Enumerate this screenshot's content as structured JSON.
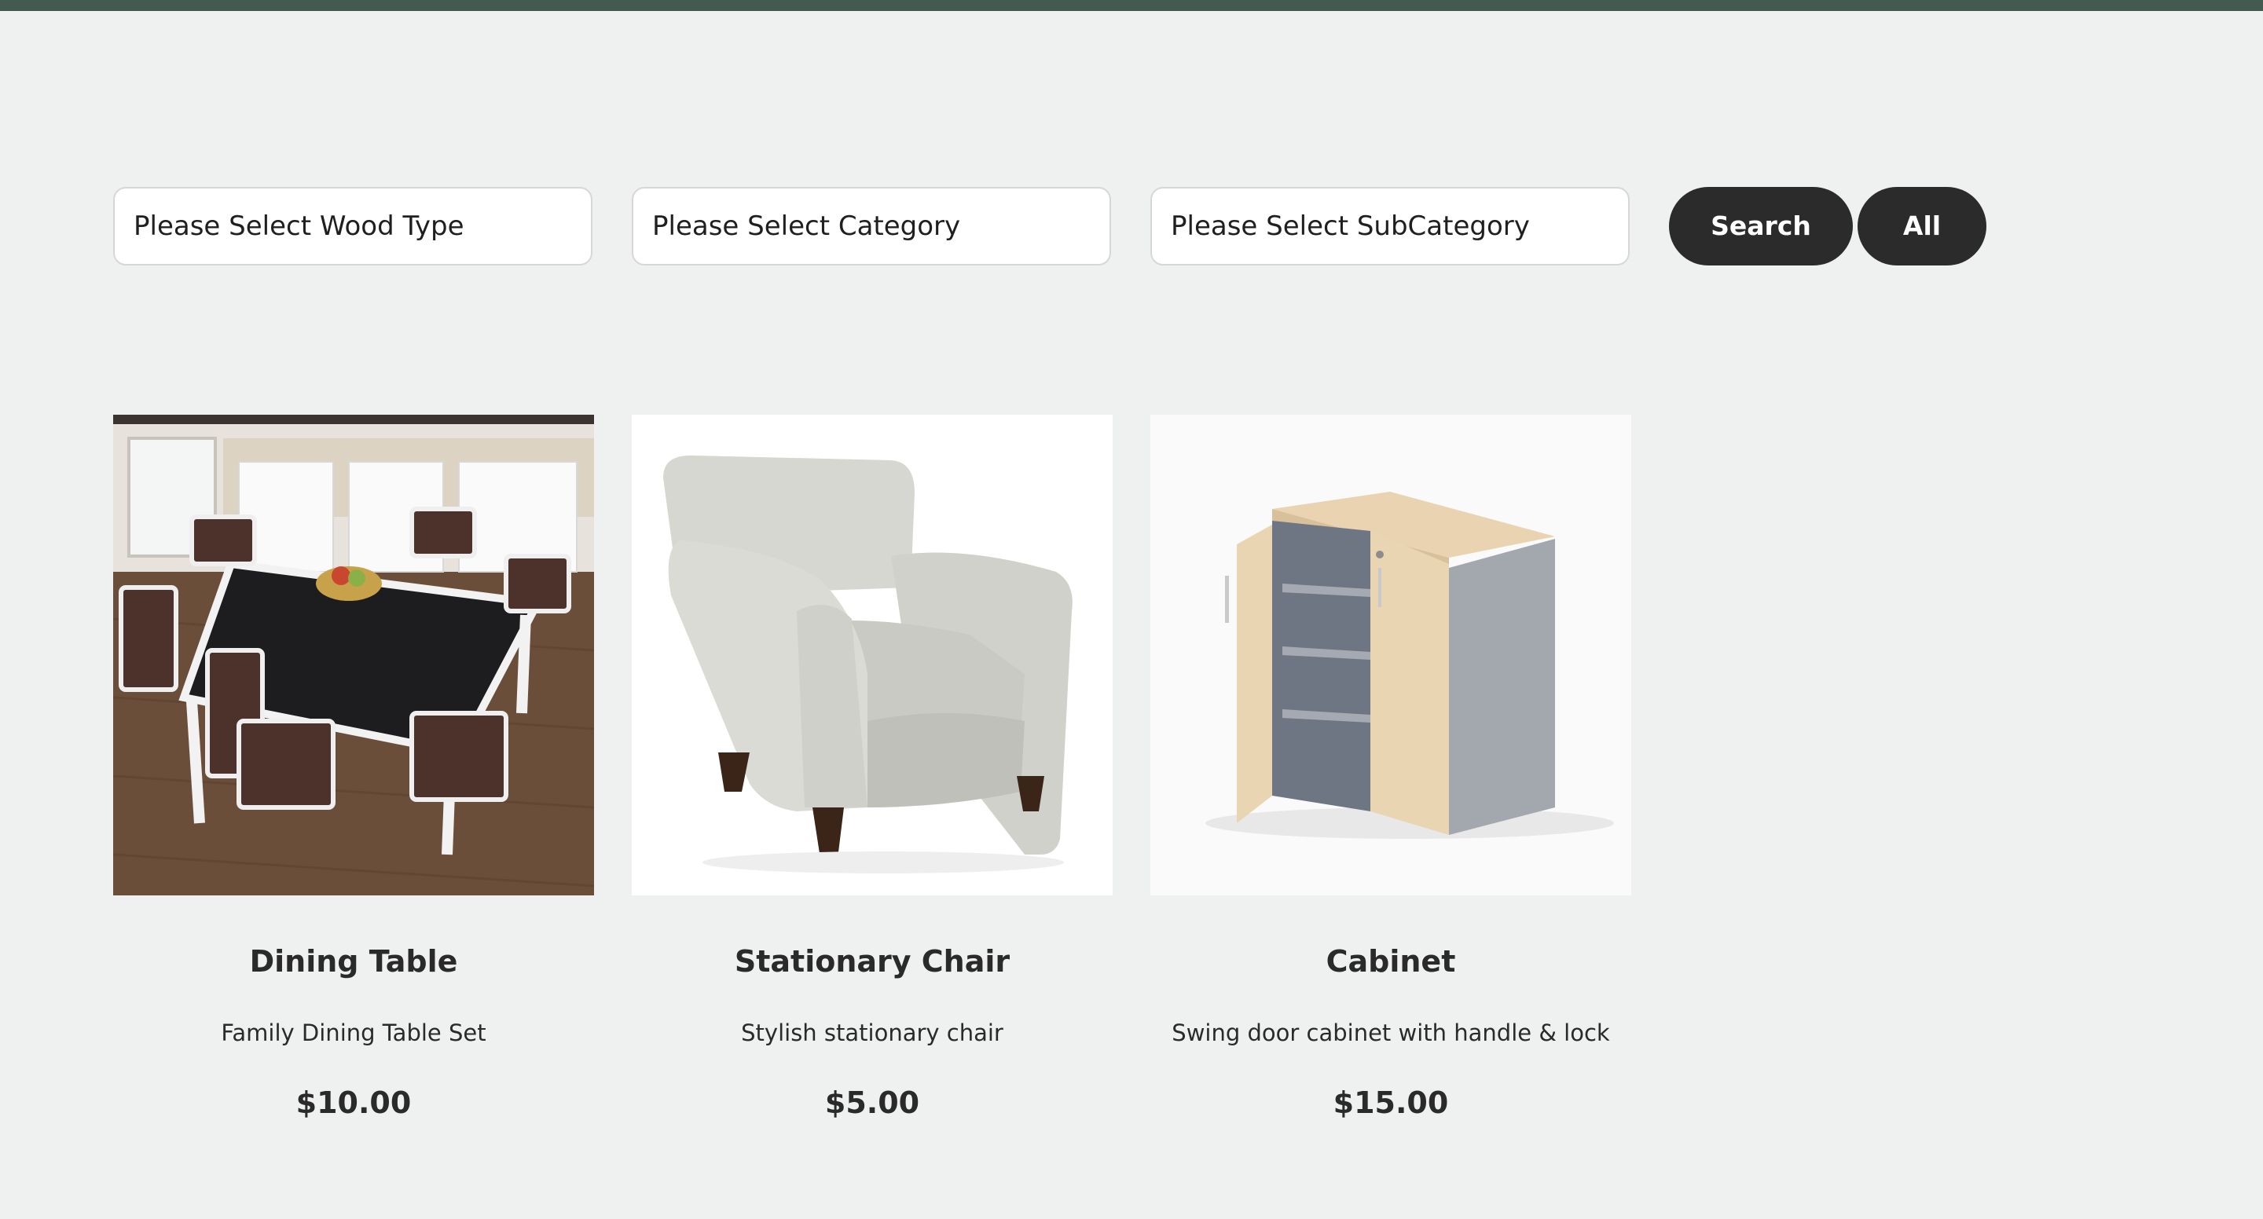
{
  "filters": {
    "wood_type": "Please Select Wood Type",
    "category": "Please Select Category",
    "subcategory": "Please Select SubCategory",
    "search_label": "Search",
    "all_label": "All"
  },
  "products": [
    {
      "name": "Dining Table",
      "description": "Family Dining Table Set",
      "price": "$10.00"
    },
    {
      "name": "Stationary Chair",
      "description": "Stylish stationary chair",
      "price": "$5.00"
    },
    {
      "name": "Cabinet",
      "description": "Swing door cabinet with handle & lock",
      "price": "$15.00"
    }
  ],
  "colors": {
    "top_bar": "#435a50",
    "page_background": "#eff1f0",
    "button_background": "#2b2b2b",
    "button_text": "#ffffff"
  }
}
